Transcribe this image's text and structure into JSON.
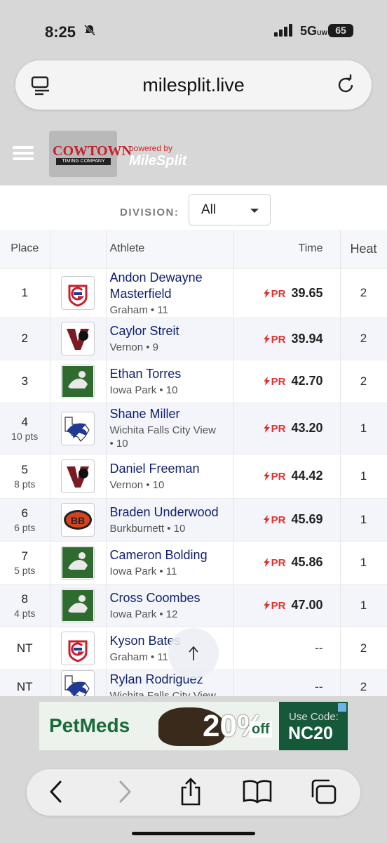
{
  "status": {
    "time": "8:25",
    "network": "5G",
    "network_sub": "UW",
    "battery": "65"
  },
  "browser": {
    "url": "milesplit.live"
  },
  "header": {
    "logo_line1": "COWTOWN",
    "logo_line2": "TIMING COMPANY",
    "powered_by": "powered by",
    "brand": "MileSplit"
  },
  "filter": {
    "label": "DIVISION:",
    "selected": "All"
  },
  "table": {
    "headers": {
      "place": "Place",
      "athlete": "Athlete",
      "time": "Time",
      "heat": "Heat"
    },
    "rows": [
      {
        "place": "1",
        "pts": "",
        "name_line1": "Andon Dewayne",
        "name_line2": "Masterfield",
        "meta": "Graham • 11",
        "meta2": "",
        "pr": "PR",
        "time": "39.65",
        "heat": "2",
        "school": "graham"
      },
      {
        "place": "2",
        "pts": "",
        "name_line1": "Caylor Streit",
        "name_line2": "",
        "meta": "Vernon • 9",
        "meta2": "",
        "pr": "PR",
        "time": "39.94",
        "heat": "2",
        "school": "vernon"
      },
      {
        "place": "3",
        "pts": "",
        "name_line1": "Ethan Torres",
        "name_line2": "",
        "meta": "Iowa Park • 10",
        "meta2": "",
        "pr": "PR",
        "time": "42.70",
        "heat": "2",
        "school": "iowa"
      },
      {
        "place": "4",
        "pts": "10 pts",
        "name_line1": "Shane Miller",
        "name_line2": "",
        "meta": "Wichita Falls City View",
        "meta2": "• 10",
        "pr": "PR",
        "time": "43.20",
        "heat": "1",
        "school": "cityview"
      },
      {
        "place": "5",
        "pts": "8 pts",
        "name_line1": "Daniel Freeman",
        "name_line2": "",
        "meta": "Vernon • 10",
        "meta2": "",
        "pr": "PR",
        "time": "44.42",
        "heat": "1",
        "school": "vernon"
      },
      {
        "place": "6",
        "pts": "6 pts",
        "name_line1": "Braden Underwood",
        "name_line2": "",
        "meta": "Burkburnett • 10",
        "meta2": "",
        "pr": "PR",
        "time": "45.69",
        "heat": "1",
        "school": "burk"
      },
      {
        "place": "7",
        "pts": "5 pts",
        "name_line1": "Cameron Bolding",
        "name_line2": "",
        "meta": "Iowa Park • 11",
        "meta2": "",
        "pr": "PR",
        "time": "45.86",
        "heat": "1",
        "school": "iowa"
      },
      {
        "place": "8",
        "pts": "4 pts",
        "name_line1": "Cross Coombes",
        "name_line2": "",
        "meta": "Iowa Park • 12",
        "meta2": "",
        "pr": "PR",
        "time": "47.00",
        "heat": "1",
        "school": "iowa"
      },
      {
        "place": "NT",
        "pts": "",
        "name_line1": "Kyson Bates",
        "name_line2": "",
        "meta": "Graham • 11",
        "meta2": "",
        "pr": "",
        "time": "--",
        "heat": "2",
        "school": "graham"
      },
      {
        "place": "NT",
        "pts": "",
        "name_line1": "Rylan Rodriguez",
        "name_line2": "",
        "meta": "Wichita Falls City View",
        "meta2": "",
        "pr": "",
        "time": "--",
        "heat": "2",
        "school": "cityview"
      }
    ]
  },
  "ad": {
    "brand": "PetMeds",
    "percent": "20%",
    "off": "off",
    "code_label": "Use Code:",
    "code": "NC20"
  },
  "colors": {
    "name": "#0d1f6e",
    "pr": "#e03131",
    "graham": "#c7202a",
    "vernon": "#7a1a22",
    "iowa": "#2f6b2f",
    "cityview": "#1f3a93",
    "burk": "#d4451f"
  }
}
